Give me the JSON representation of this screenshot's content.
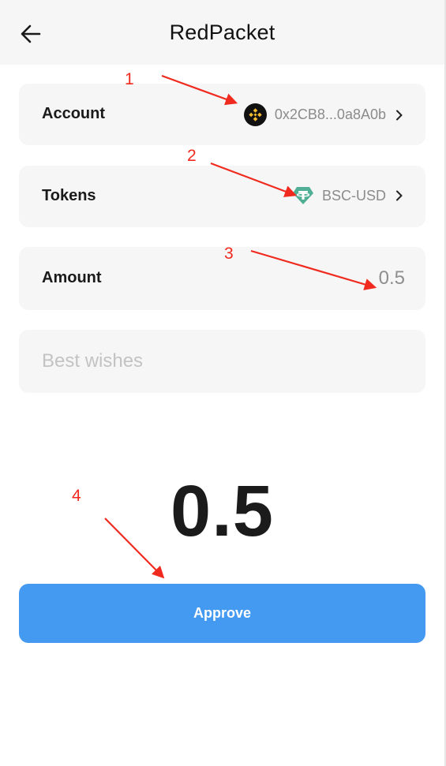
{
  "header": {
    "title": "RedPacket"
  },
  "account": {
    "label": "Account",
    "address": "0x2CB8...0a8A0b",
    "icon": "bnb-chain-icon"
  },
  "tokens": {
    "label": "Tokens",
    "value": "BSC-USD",
    "icon": "tether-usdt-icon"
  },
  "amount": {
    "label": "Amount",
    "value": "0.5"
  },
  "wishes": {
    "placeholder": "Best wishes"
  },
  "total": {
    "value": "0.5"
  },
  "approve": {
    "label": "Approve"
  },
  "annotations": {
    "n1": "1",
    "n2": "2",
    "n3": "3",
    "n4": "4"
  },
  "colors": {
    "accent": "#4499f1",
    "annotation": "#f02a1f",
    "card": "#f6f6f6",
    "bnb": "#f3ba2f",
    "tether": "#50af95"
  }
}
